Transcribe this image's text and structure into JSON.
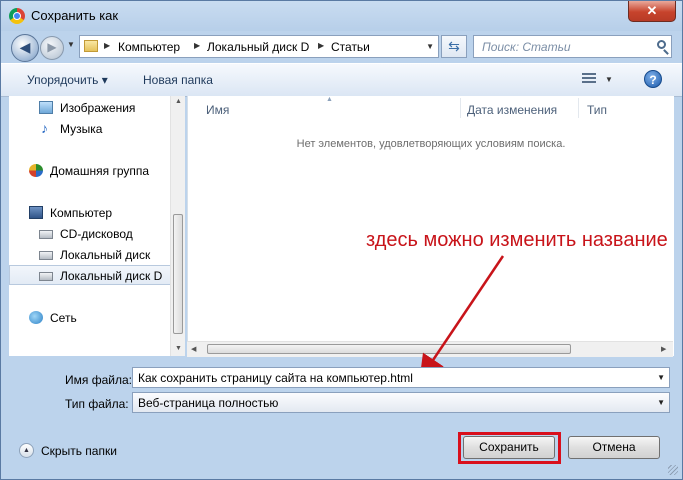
{
  "window": {
    "title": "Сохранить как",
    "close_label": "✕",
    "icon": "chrome-icon"
  },
  "navbar": {
    "breadcrumb": [
      "Компьютер",
      "Локальный диск D",
      "Статьи"
    ],
    "search_placeholder": "Поиск: Статьи"
  },
  "toolbar": {
    "organize_label": "Упорядочить ▾",
    "new_folder_label": "Новая папка",
    "help_label": "?"
  },
  "sidebar": {
    "items": [
      {
        "label": "Изображения",
        "icon": "pictures-icon"
      },
      {
        "label": "Музыка",
        "icon": "music-icon"
      },
      {
        "label": "Домашняя группа",
        "icon": "homegroup-icon"
      },
      {
        "label": "Компьютер",
        "icon": "computer-icon"
      },
      {
        "label": "CD-дисковод",
        "icon": "cd-drive-icon"
      },
      {
        "label": "Локальный диск",
        "icon": "hard-drive-icon"
      },
      {
        "label": "Локальный диск D",
        "icon": "hard-drive-icon",
        "selected": true
      },
      {
        "label": "Сеть",
        "icon": "network-icon"
      }
    ]
  },
  "file_list": {
    "columns": [
      "Имя",
      "Дата изменения",
      "Тип"
    ],
    "empty_message": "Нет элементов, удовлетворяющих условиям поиска."
  },
  "annotation": {
    "text": "здесь можно изменить название",
    "color": "#c8141a"
  },
  "form": {
    "filename_label": "Имя файла:",
    "filename_value": "Как сохранить страницу сайта на компьютер.html",
    "filetype_label": "Тип файла:",
    "filetype_value": "Веб-страница полностью"
  },
  "footer": {
    "hide_folders_label": "Скрыть папки",
    "save_label": "Сохранить",
    "cancel_label": "Отмена"
  }
}
